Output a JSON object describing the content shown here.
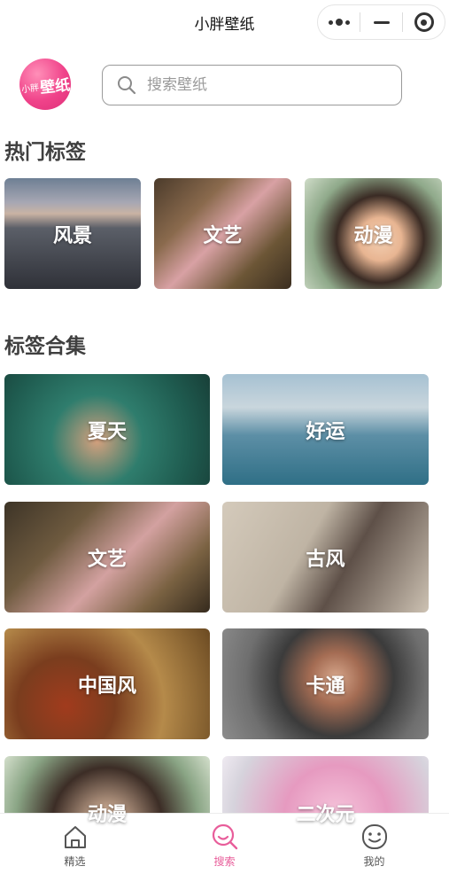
{
  "navbar": {
    "title": "小胖壁纸"
  },
  "logo": {
    "text_small": "小胖",
    "text_big": "壁纸"
  },
  "search": {
    "placeholder": "搜索壁纸",
    "value": ""
  },
  "hot_tags": {
    "title": "热门标签",
    "items": [
      {
        "label": "风景"
      },
      {
        "label": "文艺"
      },
      {
        "label": "动漫"
      }
    ]
  },
  "collections": {
    "title": "标签合集",
    "items": [
      {
        "label": "夏天"
      },
      {
        "label": "好运"
      },
      {
        "label": "文艺"
      },
      {
        "label": "古风"
      },
      {
        "label": "中国风"
      },
      {
        "label": "卡通"
      },
      {
        "label": "动漫"
      },
      {
        "label": "二次元"
      }
    ]
  },
  "tabbar": {
    "items": [
      {
        "label": "精选",
        "icon": "home-icon",
        "active": false
      },
      {
        "label": "搜索",
        "icon": "search-icon",
        "active": true
      },
      {
        "label": "我的",
        "icon": "smiley-icon",
        "active": false
      }
    ],
    "active_color": "#e85d9a",
    "inactive_color": "#555555"
  },
  "colors": {
    "brand_pink": "#f0438a",
    "section_title": "#3f3f3f"
  }
}
